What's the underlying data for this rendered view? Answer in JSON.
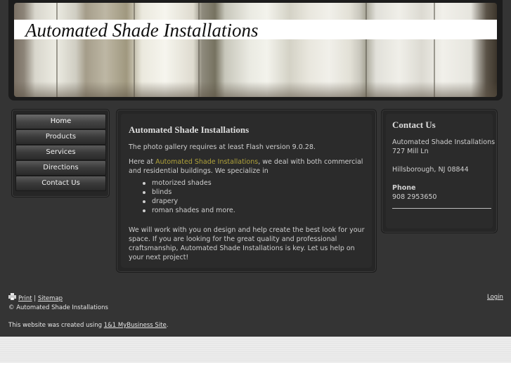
{
  "header": {
    "site_title": "Automated Shade Installations"
  },
  "nav": {
    "items": [
      {
        "label": "Home",
        "active": true
      },
      {
        "label": "Products"
      },
      {
        "label": "Services"
      },
      {
        "label": "Directions"
      },
      {
        "label": "Contact Us"
      }
    ]
  },
  "main": {
    "heading": "Automated Shade Installations",
    "flash_note": "The photo gallery requires at least Flash version 9.0.28.",
    "intro_before": "Here at ",
    "intro_link": "Automated Shade Installations",
    "intro_after": ", we deal with both commercial and residential buildings. We specialize in",
    "bullets": [
      "motorized shades",
      "blinds",
      "drapery",
      "roman shades and more."
    ],
    "closing": "We will work with you on design and help create the best look for your space. If you are looking for the great quality and professional craftsmanship, Automated Shade Installations is key. Let us help on your next project!"
  },
  "contact": {
    "heading": "Contact Us",
    "company": "Automated Shade Installations",
    "street": "727 Mill Ln",
    "city": "Hillsborough, NJ 08844",
    "phone_label": "Phone",
    "phone": "908 2953650"
  },
  "footer": {
    "print_label": "Print",
    "separator": "|",
    "sitemap_label": "Sitemap",
    "copyright": "© Automated Shade Installations",
    "login_label": "Login",
    "created_prefix": "This website was created using ",
    "created_link": "1&1 MyBusiness Site",
    "created_suffix": "."
  },
  "colors": {
    "page_background": "#343434",
    "panel_background": "#2b2b2b",
    "link_highlight": "#b0a23a",
    "text": "#cfcfcf"
  }
}
